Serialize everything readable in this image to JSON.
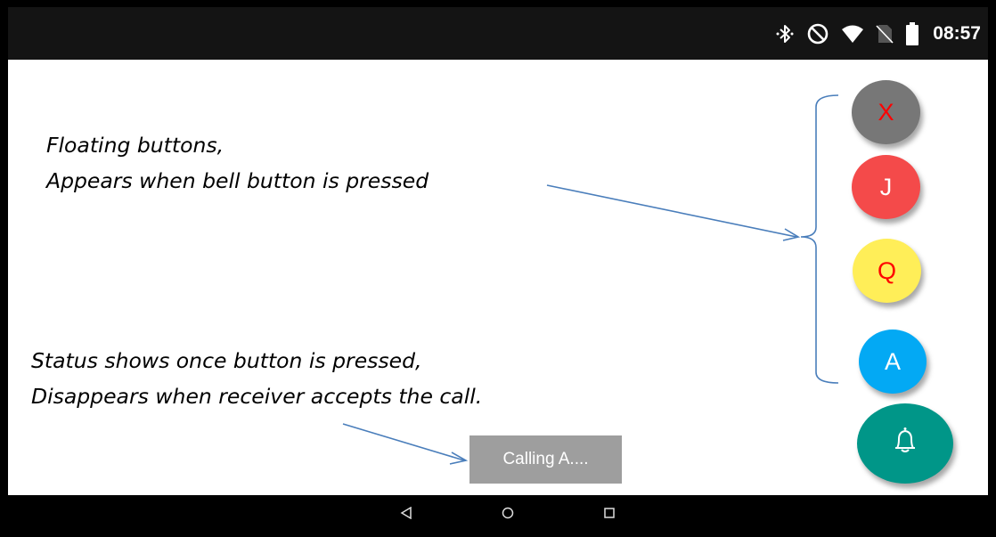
{
  "status_bar": {
    "time": "08:57",
    "icons": [
      "bluetooth-icon",
      "do-not-disturb-icon",
      "wifi-icon",
      "no-sim-icon",
      "battery-icon"
    ]
  },
  "annotations": {
    "floating_line1": "Floating buttons,",
    "floating_line2": "Appears when bell button is pressed",
    "status_line1": "Status shows once button is pressed,",
    "status_line2": "Disappears when receiver accepts the call."
  },
  "floating_buttons": [
    {
      "label": "X",
      "color": "#777777",
      "text_color": "#ff0000"
    },
    {
      "label": "J",
      "color": "#f44a4a",
      "text_color": "#ffffff"
    },
    {
      "label": "Q",
      "color": "#ffee58",
      "text_color": "#ff0000"
    },
    {
      "label": "A",
      "color": "#03a9f4",
      "text_color": "#ffffff"
    }
  ],
  "bell_button": {
    "icon": "bell-icon",
    "color": "#009688"
  },
  "toast": {
    "text": "Calling A...."
  },
  "nav_bar": {
    "buttons": [
      "back-icon",
      "home-icon",
      "recents-icon"
    ]
  },
  "annotation_color": "#4a7ebb"
}
